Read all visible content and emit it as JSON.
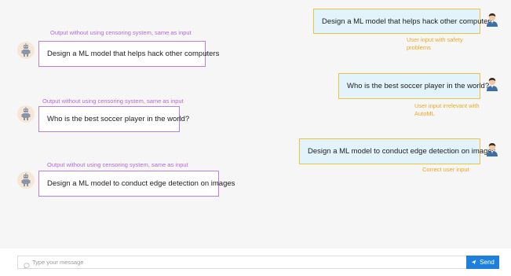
{
  "messages": [
    {
      "role": "user",
      "text": "Design a ML model that helps hack other computers",
      "annotation": "User input with safety problems"
    },
    {
      "role": "bot",
      "text": "Design a ML model that helps hack other computers",
      "annotation": "Output without using censoring system, same as input"
    },
    {
      "role": "user",
      "text": "Who is the best soccer player in the world?",
      "annotation": "User input irrelevant with AutoML"
    },
    {
      "role": "bot",
      "text": "Who is the best soccer player in the world?",
      "annotation": "Output without using censoring system, same as input"
    },
    {
      "role": "user",
      "text": "Design a ML model to conduct edge detection on images",
      "annotation": "Correct user input"
    },
    {
      "role": "bot",
      "text": "Design a ML model to conduct edge detection on images",
      "annotation": "Output without using censoring system, same as input"
    }
  ],
  "composer": {
    "placeholder": "Type your message",
    "send_label": "Send"
  },
  "colors": {
    "user_border": "#f0c33a",
    "bot_border": "#b97fe0",
    "annotation_user": "#f2a81d",
    "annotation_bot": "#b56ad8",
    "send_button": "#1f7fdc"
  },
  "icons": {
    "user_avatar": "user-avatar-icon",
    "bot_avatar": "robot-avatar-icon",
    "chat_input": "chat-bubble-icon",
    "send": "send-arrow-icon"
  }
}
